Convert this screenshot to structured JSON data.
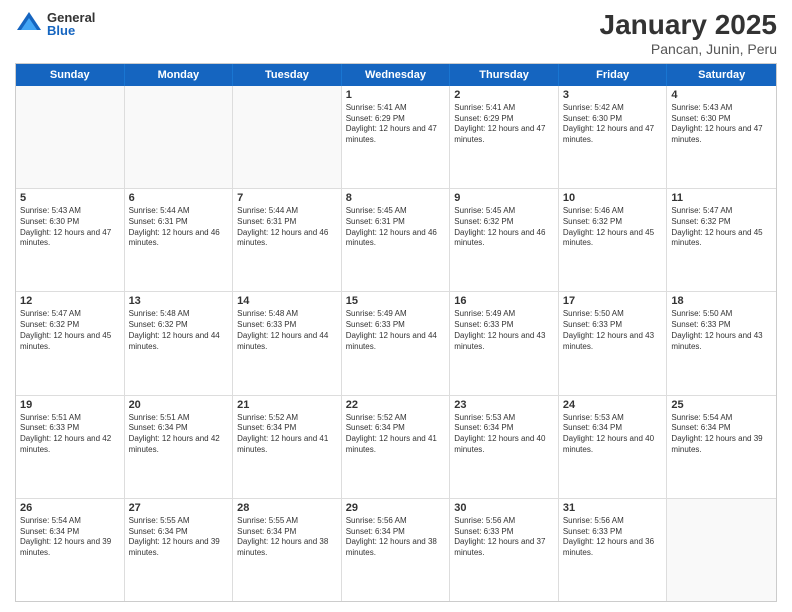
{
  "logo": {
    "general": "General",
    "blue": "Blue"
  },
  "title": {
    "month": "January 2025",
    "location": "Pancan, Junin, Peru"
  },
  "weekdays": [
    "Sunday",
    "Monday",
    "Tuesday",
    "Wednesday",
    "Thursday",
    "Friday",
    "Saturday"
  ],
  "weeks": [
    [
      {
        "day": "",
        "sunrise": "",
        "sunset": "",
        "daylight": ""
      },
      {
        "day": "",
        "sunrise": "",
        "sunset": "",
        "daylight": ""
      },
      {
        "day": "",
        "sunrise": "",
        "sunset": "",
        "daylight": ""
      },
      {
        "day": "1",
        "sunrise": "Sunrise: 5:41 AM",
        "sunset": "Sunset: 6:29 PM",
        "daylight": "Daylight: 12 hours and 47 minutes."
      },
      {
        "day": "2",
        "sunrise": "Sunrise: 5:41 AM",
        "sunset": "Sunset: 6:29 PM",
        "daylight": "Daylight: 12 hours and 47 minutes."
      },
      {
        "day": "3",
        "sunrise": "Sunrise: 5:42 AM",
        "sunset": "Sunset: 6:30 PM",
        "daylight": "Daylight: 12 hours and 47 minutes."
      },
      {
        "day": "4",
        "sunrise": "Sunrise: 5:43 AM",
        "sunset": "Sunset: 6:30 PM",
        "daylight": "Daylight: 12 hours and 47 minutes."
      }
    ],
    [
      {
        "day": "5",
        "sunrise": "Sunrise: 5:43 AM",
        "sunset": "Sunset: 6:30 PM",
        "daylight": "Daylight: 12 hours and 47 minutes."
      },
      {
        "day": "6",
        "sunrise": "Sunrise: 5:44 AM",
        "sunset": "Sunset: 6:31 PM",
        "daylight": "Daylight: 12 hours and 46 minutes."
      },
      {
        "day": "7",
        "sunrise": "Sunrise: 5:44 AM",
        "sunset": "Sunset: 6:31 PM",
        "daylight": "Daylight: 12 hours and 46 minutes."
      },
      {
        "day": "8",
        "sunrise": "Sunrise: 5:45 AM",
        "sunset": "Sunset: 6:31 PM",
        "daylight": "Daylight: 12 hours and 46 minutes."
      },
      {
        "day": "9",
        "sunrise": "Sunrise: 5:45 AM",
        "sunset": "Sunset: 6:32 PM",
        "daylight": "Daylight: 12 hours and 46 minutes."
      },
      {
        "day": "10",
        "sunrise": "Sunrise: 5:46 AM",
        "sunset": "Sunset: 6:32 PM",
        "daylight": "Daylight: 12 hours and 45 minutes."
      },
      {
        "day": "11",
        "sunrise": "Sunrise: 5:47 AM",
        "sunset": "Sunset: 6:32 PM",
        "daylight": "Daylight: 12 hours and 45 minutes."
      }
    ],
    [
      {
        "day": "12",
        "sunrise": "Sunrise: 5:47 AM",
        "sunset": "Sunset: 6:32 PM",
        "daylight": "Daylight: 12 hours and 45 minutes."
      },
      {
        "day": "13",
        "sunrise": "Sunrise: 5:48 AM",
        "sunset": "Sunset: 6:32 PM",
        "daylight": "Daylight: 12 hours and 44 minutes."
      },
      {
        "day": "14",
        "sunrise": "Sunrise: 5:48 AM",
        "sunset": "Sunset: 6:33 PM",
        "daylight": "Daylight: 12 hours and 44 minutes."
      },
      {
        "day": "15",
        "sunrise": "Sunrise: 5:49 AM",
        "sunset": "Sunset: 6:33 PM",
        "daylight": "Daylight: 12 hours and 44 minutes."
      },
      {
        "day": "16",
        "sunrise": "Sunrise: 5:49 AM",
        "sunset": "Sunset: 6:33 PM",
        "daylight": "Daylight: 12 hours and 43 minutes."
      },
      {
        "day": "17",
        "sunrise": "Sunrise: 5:50 AM",
        "sunset": "Sunset: 6:33 PM",
        "daylight": "Daylight: 12 hours and 43 minutes."
      },
      {
        "day": "18",
        "sunrise": "Sunrise: 5:50 AM",
        "sunset": "Sunset: 6:33 PM",
        "daylight": "Daylight: 12 hours and 43 minutes."
      }
    ],
    [
      {
        "day": "19",
        "sunrise": "Sunrise: 5:51 AM",
        "sunset": "Sunset: 6:33 PM",
        "daylight": "Daylight: 12 hours and 42 minutes."
      },
      {
        "day": "20",
        "sunrise": "Sunrise: 5:51 AM",
        "sunset": "Sunset: 6:34 PM",
        "daylight": "Daylight: 12 hours and 42 minutes."
      },
      {
        "day": "21",
        "sunrise": "Sunrise: 5:52 AM",
        "sunset": "Sunset: 6:34 PM",
        "daylight": "Daylight: 12 hours and 41 minutes."
      },
      {
        "day": "22",
        "sunrise": "Sunrise: 5:52 AM",
        "sunset": "Sunset: 6:34 PM",
        "daylight": "Daylight: 12 hours and 41 minutes."
      },
      {
        "day": "23",
        "sunrise": "Sunrise: 5:53 AM",
        "sunset": "Sunset: 6:34 PM",
        "daylight": "Daylight: 12 hours and 40 minutes."
      },
      {
        "day": "24",
        "sunrise": "Sunrise: 5:53 AM",
        "sunset": "Sunset: 6:34 PM",
        "daylight": "Daylight: 12 hours and 40 minutes."
      },
      {
        "day": "25",
        "sunrise": "Sunrise: 5:54 AM",
        "sunset": "Sunset: 6:34 PM",
        "daylight": "Daylight: 12 hours and 39 minutes."
      }
    ],
    [
      {
        "day": "26",
        "sunrise": "Sunrise: 5:54 AM",
        "sunset": "Sunset: 6:34 PM",
        "daylight": "Daylight: 12 hours and 39 minutes."
      },
      {
        "day": "27",
        "sunrise": "Sunrise: 5:55 AM",
        "sunset": "Sunset: 6:34 PM",
        "daylight": "Daylight: 12 hours and 39 minutes."
      },
      {
        "day": "28",
        "sunrise": "Sunrise: 5:55 AM",
        "sunset": "Sunset: 6:34 PM",
        "daylight": "Daylight: 12 hours and 38 minutes."
      },
      {
        "day": "29",
        "sunrise": "Sunrise: 5:56 AM",
        "sunset": "Sunset: 6:34 PM",
        "daylight": "Daylight: 12 hours and 38 minutes."
      },
      {
        "day": "30",
        "sunrise": "Sunrise: 5:56 AM",
        "sunset": "Sunset: 6:33 PM",
        "daylight": "Daylight: 12 hours and 37 minutes."
      },
      {
        "day": "31",
        "sunrise": "Sunrise: 5:56 AM",
        "sunset": "Sunset: 6:33 PM",
        "daylight": "Daylight: 12 hours and 36 minutes."
      },
      {
        "day": "",
        "sunrise": "",
        "sunset": "",
        "daylight": ""
      }
    ]
  ]
}
